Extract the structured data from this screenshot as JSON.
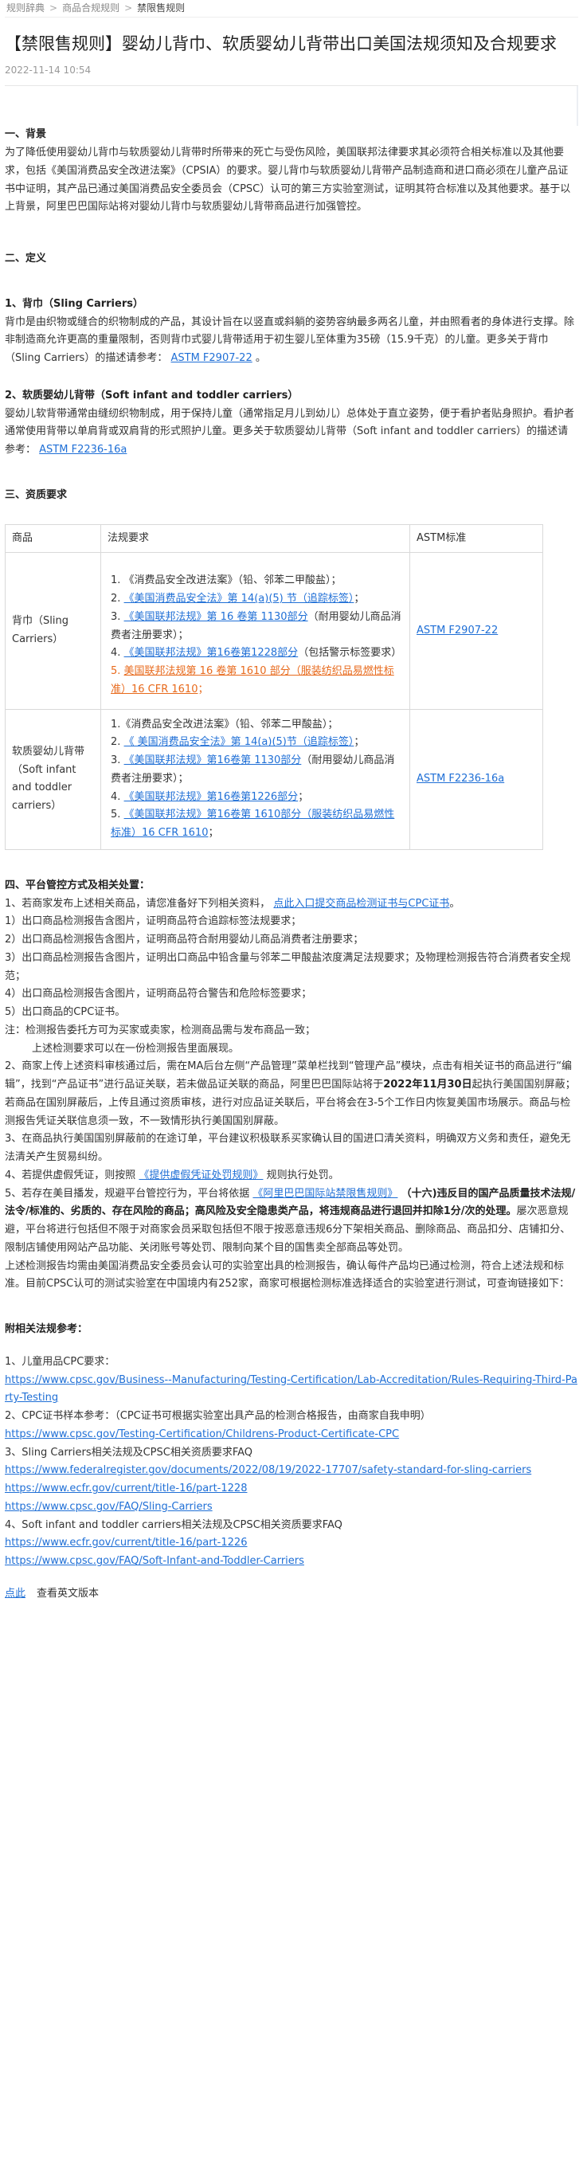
{
  "breadcrumb": [
    "规则辞典",
    "商品合规规则",
    "禁限售规则"
  ],
  "title": "【禁限售规则】婴幼儿背巾、软质婴幼儿背带出口美国法规须知及合规要求",
  "date": "2022-11-14 10:54",
  "s1": {
    "heading": "一、背景",
    "body": "为了降低使用婴幼儿背巾与软质婴幼儿背带时所带来的死亡与受伤风险，美国联邦法律要求其必须符合相关标准以及其他要求，包括《美国消费品安全改进法案》（CPSIA）的要求。婴儿背巾与软质婴幼儿背带产品制造商和进口商必须在儿童产品证书中证明，其产品已通过美国消费品安全委员会（CPSC）认可的第三方实验室测试，证明其符合标准以及其他要求。基于以上背景，阿里巴巴国际站将对婴幼儿背巾与软质婴幼儿背带商品进行加强管控。"
  },
  "s2": {
    "heading": "二、定义",
    "sub1": "1、背巾（Sling Carriers）",
    "sub1_body": "背巾是由织物或缝合的织物制成的产品，其设计旨在以竖直或斜躺的姿势容纳最多两名儿童，并由照看者的身体进行支撑。除非制造商允许更高的重量限制，否则背巾式婴儿背带适用于初生婴儿至体重为35磅（15.9千克）的儿童。更多关于背巾（Sling Carriers）的描述请参考：",
    "sub1_link": "ASTM F2907-22",
    "sub1_tail": "。",
    "sub2": "2、软质婴幼儿背带（Soft infant and toddler carriers）",
    "sub2_body": "婴幼儿软背带通常由缝纫织物制成，用于保持儿童（通常指足月儿到幼儿）总体处于直立姿势，便于看护者贴身照护。看护者通常使用背带以单肩背或双肩背的形式照护儿童。更多关于软质婴幼儿背带（Soft infant and toddler carriers）的描述请参考：",
    "sub2_link": "ASTM F2236-16a"
  },
  "s3": {
    "heading": "三、资质要求",
    "headers": [
      "商品",
      "法规要求",
      "ASTM标准"
    ],
    "row1": {
      "product": "背巾（Sling Carriers）",
      "items": [
        {
          "n": "1.",
          "text": "《消费品安全改进法案》（铅、邻苯二甲酸盐）；"
        },
        {
          "n": "2.",
          "link": "《美国消费品安全法》第 14(a)(5) 节（追踪标签）",
          "tail": "；"
        },
        {
          "n": "3.",
          "link": "《美国联邦法规》第 16 卷第 1130部分",
          "tail": "（耐用婴幼儿商品消费者注册要求）；"
        },
        {
          "n": "4.",
          "link": "《美国联邦法规》第16卷第1228部分",
          "tail": "（包括警示标签要求）"
        },
        {
          "n": "5.",
          "link": "美国联邦法规第 16 卷第 1610 部分（服装纺织品易燃性标准）16 CFR 1610",
          "tail": "；"
        }
      ],
      "astm": "ASTM F2907-22"
    },
    "row2": {
      "product": "软质婴幼儿背带（Soft infant and toddler carriers）",
      "items": [
        {
          "n": "1.",
          "text": "《消费品安全改进法案》（铅、邻苯二甲酸盐）；"
        },
        {
          "n": "2.",
          "link": "《 美国消费品安全法》第 14(a)(5)节（追踪标签）",
          "tail": "；"
        },
        {
          "n": "3.",
          "link": "《美国联邦法规》第16卷第 1130部分",
          "tail": "（耐用婴幼儿商品消费者注册要求）；"
        },
        {
          "n": "4.",
          "link": "《美国联邦法规》第16卷第1226部分",
          "tail": "；"
        },
        {
          "n": "5.",
          "link": "《美国联邦法规》第16卷第 1610部分（服装纺织品易燃性标准）16 CFR 1610",
          "tail": "；"
        }
      ],
      "astm": "ASTM F2236-16a"
    }
  },
  "s4": {
    "heading": "四、平台管控方式及相关处置：",
    "p1_pre": "1、若商家发布上述相关商品，请您准备好下列相关资料，",
    "p1_link": "点此入口提交商品检测证书与CPC证书",
    "p1_tail": "。",
    "list": [
      "1）出口商品检测报告含图片，证明商品符合追踪标签法规要求；",
      "2）出口商品检测报告含图片，证明商品符合耐用婴幼儿商品消费者注册要求；",
      "3）出口商品检测报告含图片，证明出口商品中铅含量与邻苯二甲酸盐浓度满足法规要求；及物理检测报告符合消费者安全规范；",
      "4）出口商品检测报告含图片，证明商品符合警告和危险标签要求；",
      "5）出口商品的CPC证书。"
    ],
    "note1": "注：检测报告委托方可为买家或卖家，检测商品需与发布商品一致；",
    "note2": "上述检测要求可以在一份检测报告里面展现。",
    "p2_a": "2、商家上传上述资料审核通过后，需在MA后台左侧“产品管理”菜单栏找到“管理产品”模块，点击有相关证书的商品进行“编辑”，找到“产品证书”进行品证关联，若未做品证关联的商品，阿里巴巴国际站将于",
    "p2_bold": "2022年11月30日",
    "p2_b": "起执行美国国别屏蔽；若商品在国别屏蔽后，上传且通过资质审核，进行对应品证关联后，平台将会在3-5个工作日内恢复美国市场展示。商品与检测报告凭证关联信息须一致，不一致情形执行美国国别屏蔽。",
    "p3": "3、在商品执行美国国别屏蔽前的在途订单，平台建议积极联系买家确认目的国进口清关资料，明确双方义务和责任，避免无法清关产生贸易纠纷。",
    "p4_pre": "4、若提供虚假凭证，则按照",
    "p4_link": "《提供虚假凭证处罚规则》",
    "p4_tail": "规则执行处罚。",
    "p5_pre": "5、若存在美目播发，规避平台管控行为，平台将依据",
    "p5_link": "《阿里巴巴国际站禁限售规则》",
    "p5_bold": "（十六)违反目的国产品质量技术法规/法令/标准的、劣质的、存在风险的商品；高风险及安全隐患类产品，将违规商品进行退回并扣除1分/次的处理。",
    "p5_tail": "屡次恶意规避，平台将进行包括但不限于对商家会员采取包括但不限于按恶意违规6分下架相关商品、删除商品、商品扣分、店铺扣分、限制店铺使用网站产品功能、关闭账号等处罚、限制向某个目的国售卖全部商品等处罚。",
    "p6": "上述检测报告均需由美国消费品安全委员会认可的实验室出具的检测报告，确认每件产品均已通过检测，符合上述法规和标准。目前CPSC认可的测试实验室在中国境内有252家，商家可根据检测标准选择适合的实验室进行测试，可查询链接如下："
  },
  "refs": {
    "heading": "附相关法规参考：",
    "groups": [
      {
        "label": "1、儿童用品CPC要求：",
        "urls": [
          "https://www.cpsc.gov/Business--Manufacturing/Testing-Certification/Lab-Accreditation/Rules-Requiring-Third-Party-Testing"
        ]
      },
      {
        "label": "2、CPC证书样本参考：（CPC证书可根据实验室出具产品的检测合格报告，由商家自我申明）",
        "urls": [
          "https://www.cpsc.gov/Testing-Certification/Childrens-Product-Certificate-CPC"
        ]
      },
      {
        "label": "3、Sling Carriers相关法规及CPSC相关资质要求FAQ",
        "urls": [
          "https://www.federalregister.gov/documents/2022/08/19/2022-17707/safety-standard-for-sling-carriers",
          "https://www.ecfr.gov/current/title-16/part-1228",
          "https://www.cpsc.gov/FAQ/Sling-Carriers"
        ]
      },
      {
        "label": "4、Soft infant and toddler carriers相关法规及CPSC相关资质要求FAQ",
        "urls": [
          "https://www.ecfr.gov/current/title-16/part-1226",
          "https://www.cpsc.gov/FAQ/Soft-Infant-and-Toddler-Carriers"
        ]
      }
    ]
  },
  "footer": {
    "click": "点此",
    "text": "查看英文版本"
  },
  "colors": {
    "link": "#1f6fd6",
    "warning_link": "#e86a1c"
  }
}
